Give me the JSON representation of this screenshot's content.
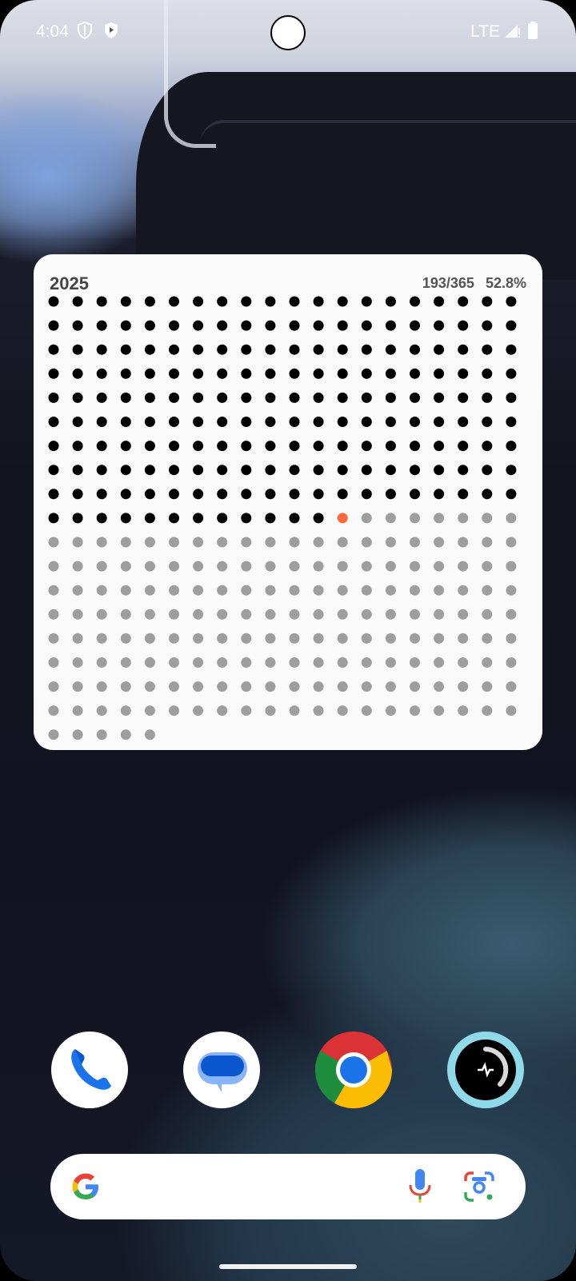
{
  "status_bar": {
    "time": "4:04",
    "icons": [
      "shield-outline-icon",
      "shield-play-icon"
    ],
    "network": "LTE",
    "right_icons": [
      "signal-icon",
      "battery-icon"
    ]
  },
  "widget": {
    "year": "2025",
    "progress_text": "193/365",
    "percent_text": "52.8%",
    "days_total": 365,
    "days_elapsed": 192,
    "today_index": 193,
    "columns": 20,
    "rows": 18,
    "colors": {
      "elapsed": "#000000",
      "today": "#ff6a3d",
      "remaining": "#9e9e9e"
    }
  },
  "dock": {
    "apps": [
      {
        "name": "Phone",
        "icon": "phone-icon"
      },
      {
        "name": "Messages",
        "icon": "messages-icon"
      },
      {
        "name": "Chrome",
        "icon": "chrome-icon"
      },
      {
        "name": "Fitness",
        "icon": "fitness-ring-icon"
      }
    ]
  },
  "search": {
    "icons": [
      "google-g-icon",
      "microphone-icon",
      "google-lens-icon"
    ]
  }
}
